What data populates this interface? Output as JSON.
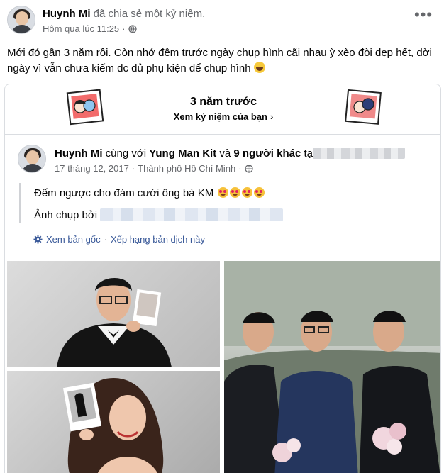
{
  "post": {
    "author": "Huynh Mi",
    "action": "đã chia sẻ một kỷ niệm.",
    "time": "Hôm qua lúc 11:25",
    "separator": "·",
    "more_label": "•••",
    "text": "Mới đó gần 3 năm rồi. Còn nhớ đêm trước ngày chụp hình cãi nhau ỳ xèo đòi dẹp hết, dời ngày vì vẫn chưa kiếm đc đủ phụ kiện để chụp hình"
  },
  "memory": {
    "title": "3 năm trước",
    "link": "Xem kỷ niệm của bạn",
    "chevron": "›"
  },
  "inner_post": {
    "author": "Huynh Mi",
    "with_text": "cùng với",
    "tagged": "Yung Man Kit",
    "and_text": "và",
    "others": "9 người khác",
    "at_text": "tạ",
    "date": "17 tháng 12, 2017",
    "separator": "·",
    "location": "Thành phố Hồ Chí Minh",
    "caption": "Đếm ngược cho đám cưới ông bà KM",
    "photo_credit_label": "Ảnh chụp bởi",
    "see_original": "Xem bản gốc",
    "rate_translation": "Xếp hạng bản dịch này",
    "dot": "·"
  },
  "colors": {
    "link_blue": "#385898",
    "secondary_text": "#65676b",
    "border": "#dadde1"
  },
  "icons": {
    "globe": "globe-icon",
    "more": "more-icon",
    "gear": "gear-icon",
    "chevron": "chevron-right-icon"
  }
}
